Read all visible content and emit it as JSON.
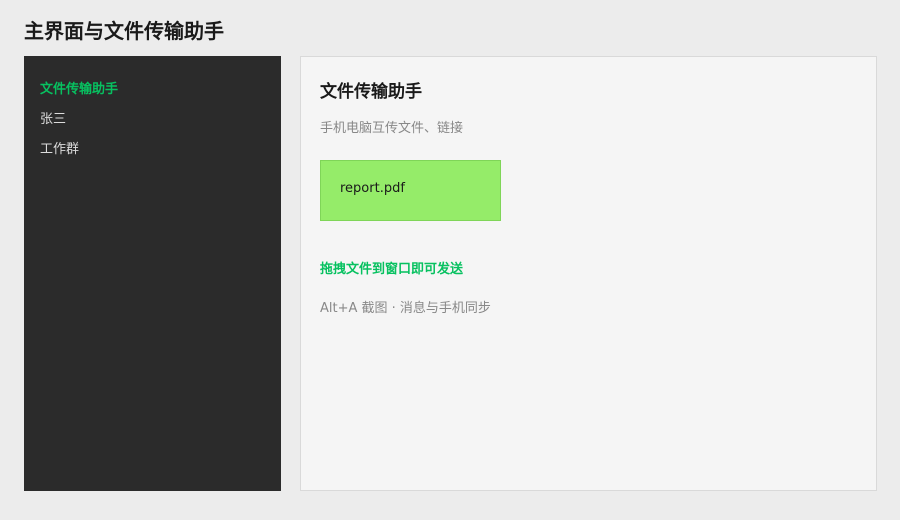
{
  "page": {
    "title": "主界面与文件传输助手"
  },
  "sidebar": {
    "items": [
      {
        "label": "文件传输助手",
        "active": true
      },
      {
        "label": "张三",
        "active": false
      },
      {
        "label": "工作群",
        "active": false
      }
    ]
  },
  "chat": {
    "title": "文件传输助手",
    "subtitle": "手机电脑互传文件、链接",
    "file_message": {
      "file_name": "report.pdf"
    },
    "drag_hint": "拖拽文件到窗口即可发送",
    "shortcut_hint": "Alt+A 截图 · 消息与手机同步"
  },
  "colors": {
    "accent": "#07c160",
    "sidebar_bg": "#2b2b2b",
    "file_bubble": "#95ec69",
    "main_bg": "#f5f5f5"
  }
}
